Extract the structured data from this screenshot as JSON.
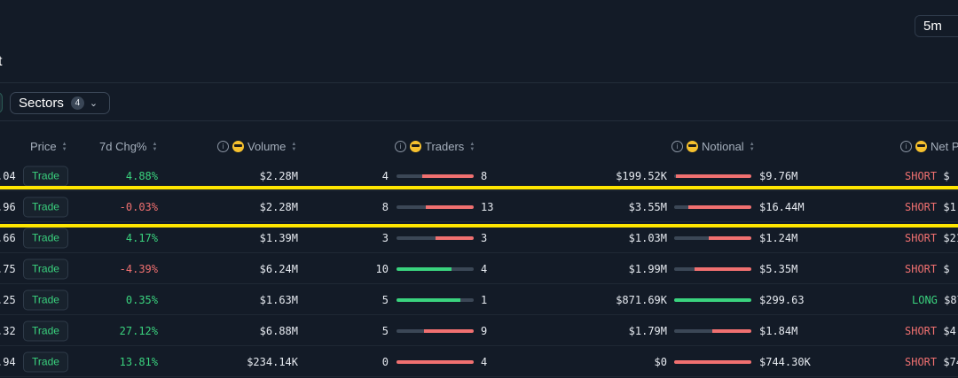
{
  "timeframe": "5m",
  "title_fragment": "t",
  "filters": {
    "sectors_label": "Sectors",
    "sectors_count": "4"
  },
  "headers": {
    "price": "Price",
    "chg": "7d Chg%",
    "volume": "Volume",
    "traders": "Traders",
    "notional": "Notional",
    "net": "Net P"
  },
  "trade_label": "Trade",
  "colors": {
    "green": "#3ad37e",
    "red": "#f07070",
    "bar_track": "#3b4756",
    "highlight": "#ffe600"
  },
  "rows": [
    {
      "price": ".04",
      "chg": "4.88%",
      "chg_dir": "up",
      "volume": "$2.28M",
      "tr_left": "4",
      "tr_right": "8",
      "tr_long_frac": 0.33,
      "n_left": "$199.52K",
      "n_right": "$9.76M",
      "n_long_frac": 0.02,
      "side": "SHORT",
      "net": "$"
    },
    {
      "price": ".96",
      "chg": "-0.03%",
      "chg_dir": "down",
      "volume": "$2.28M",
      "tr_left": "8",
      "tr_right": "13",
      "tr_long_frac": 0.38,
      "n_left": "$3.55M",
      "n_right": "$16.44M",
      "n_long_frac": 0.18,
      "side": "SHORT",
      "net": "$1"
    },
    {
      "price": ".66",
      "chg": "4.17%",
      "chg_dir": "up",
      "volume": "$1.39M",
      "tr_left": "3",
      "tr_right": "3",
      "tr_long_frac": 0.5,
      "n_left": "$1.03M",
      "n_right": "$1.24M",
      "n_long_frac": 0.45,
      "side": "SHORT",
      "net": "$21"
    },
    {
      "price": ".75",
      "chg": "-4.39%",
      "chg_dir": "down",
      "volume": "$6.24M",
      "tr_left": "10",
      "tr_right": "4",
      "tr_long_frac": 0.71,
      "n_left": "$1.99M",
      "n_right": "$5.35M",
      "n_long_frac": 0.27,
      "side": "SHORT",
      "net": "$"
    },
    {
      "price": ".25",
      "chg": "0.35%",
      "chg_dir": "up",
      "volume": "$1.63M",
      "tr_left": "5",
      "tr_right": "1",
      "tr_long_frac": 0.83,
      "n_left": "$871.69K",
      "n_right": "$299.63",
      "n_long_frac": 1.0,
      "side": "LONG",
      "net": "$87"
    },
    {
      "price": ".32",
      "chg": "27.12%",
      "chg_dir": "up",
      "volume": "$6.88M",
      "tr_left": "5",
      "tr_right": "9",
      "tr_long_frac": 0.36,
      "n_left": "$1.79M",
      "n_right": "$1.84M",
      "n_long_frac": 0.49,
      "side": "SHORT",
      "net": "$4"
    },
    {
      "price": ".94",
      "chg": "13.81%",
      "chg_dir": "up",
      "volume": "$234.14K",
      "tr_left": "0",
      "tr_right": "4",
      "tr_long_frac": 0.0,
      "n_left": "$0",
      "n_right": "$744.30K",
      "n_long_frac": 0.0,
      "side": "SHORT",
      "net": "$74"
    }
  ]
}
